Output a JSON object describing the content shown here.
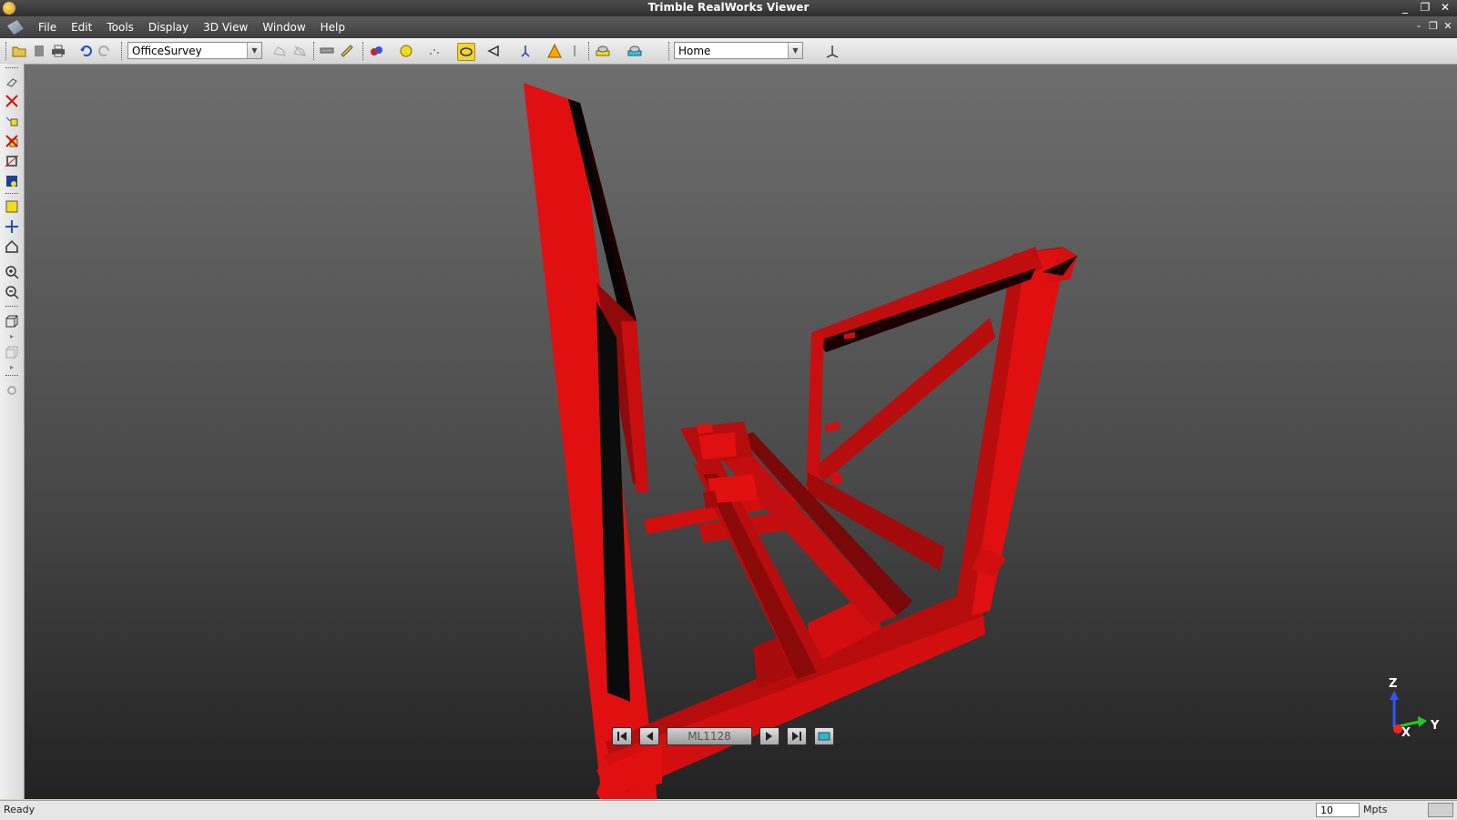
{
  "window": {
    "title": "Trimble RealWorks Viewer",
    "controls": [
      "_",
      "❐",
      "✕"
    ]
  },
  "menu": {
    "items": [
      "File",
      "Edit",
      "Tools",
      "Display",
      "3D View",
      "Window",
      "Help"
    ],
    "mdi_controls": [
      "-",
      "❐",
      "✕"
    ]
  },
  "toolbar": {
    "project": "OfficeSurvey",
    "view": "Home",
    "icons": [
      "open-icon",
      "save-icon",
      "print-icon",
      "undo-icon",
      "redo-icon",
      "fence-icon",
      "fence-clear-icon",
      "measure-icon",
      "ruler-icon",
      "color-mode-icon",
      "sphere-icon",
      "points-icon",
      "target-icon",
      "camera-icon",
      "station-icon",
      "warning-icon",
      "info-icon",
      "layer-icon",
      "display-icon",
      "axis-icon"
    ]
  },
  "player": {
    "station": "ML1128"
  },
  "axes": {
    "z": "Z",
    "x": "X",
    "y": "Y",
    "colors": {
      "z": "#3355ff",
      "x": "#ff2222",
      "y": "#22cc22"
    }
  },
  "status": {
    "text": "Ready",
    "points_value": "10",
    "points_unit": "Mpts"
  },
  "colors": {
    "model_red": "#e01010",
    "model_dark": "#7a0808"
  }
}
